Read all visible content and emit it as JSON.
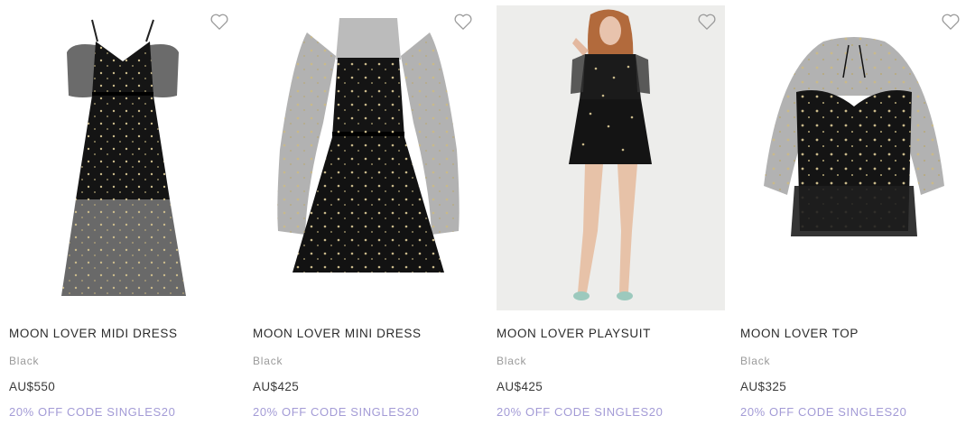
{
  "products": [
    {
      "name": "MOON LOVER MIDI DRESS",
      "color": "Black",
      "price": "AU$550",
      "promo": "20% OFF CODE SINGLES20"
    },
    {
      "name": "MOON LOVER MINI DRESS",
      "color": "Black",
      "price": "AU$425",
      "promo": "20% OFF CODE SINGLES20"
    },
    {
      "name": "MOON LOVER PLAYSUIT",
      "color": "Black",
      "price": "AU$425",
      "promo": "20% OFF CODE SINGLES20"
    },
    {
      "name": "MOON LOVER TOP",
      "color": "Black",
      "price": "AU$325",
      "promo": "20% OFF CODE SINGLES20"
    }
  ],
  "icons": {
    "wishlist": "heart-outline-icon"
  },
  "colors": {
    "promo": "#a39bd6",
    "title": "#2b2b2b",
    "muted": "#9a9a9a"
  }
}
